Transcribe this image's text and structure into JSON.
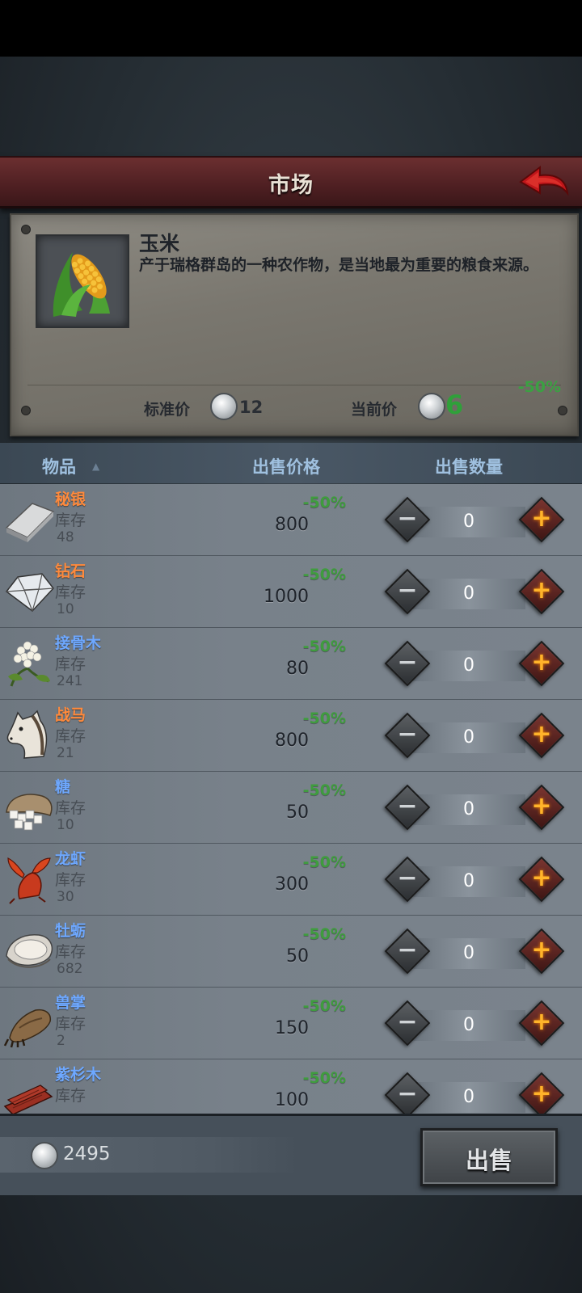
{
  "title": "市场",
  "selected_item": {
    "name": "玉米",
    "description": "产于瑞格群岛的一种农作物，是当地最为重要的粮食来源。",
    "discount": "-50%",
    "standard_price_label": "标准价",
    "standard_price": "12",
    "current_price_label": "当前价",
    "current_price": "6",
    "icon": "corn-icon"
  },
  "table_header": {
    "item": "物品",
    "sell_price": "出售价格",
    "sell_quantity": "出售数量"
  },
  "colors": {
    "blue_name": "#6ea8ff",
    "orange_name": "#ff8a3c",
    "discount_green": "#3f9c3e"
  },
  "items": [
    {
      "name": "秘银",
      "name_color": "#ff8a3c",
      "stock_label": "库存",
      "stock": "48",
      "discount": "-50%",
      "price": "800",
      "qty": "0",
      "icon": "mithril-bar-icon"
    },
    {
      "name": "钻石",
      "name_color": "#ff8a3c",
      "stock_label": "库存",
      "stock": "10",
      "discount": "-50%",
      "price": "1000",
      "qty": "0",
      "icon": "diamond-icon"
    },
    {
      "name": "接骨木",
      "name_color": "#6ea8ff",
      "stock_label": "库存",
      "stock": "241",
      "discount": "-50%",
      "price": "80",
      "qty": "0",
      "icon": "elder-flower-icon"
    },
    {
      "name": "战马",
      "name_color": "#ff8a3c",
      "stock_label": "库存",
      "stock": "21",
      "discount": "-50%",
      "price": "800",
      "qty": "0",
      "icon": "horse-icon"
    },
    {
      "name": "糖",
      "name_color": "#6ea8ff",
      "stock_label": "库存",
      "stock": "10",
      "discount": "-50%",
      "price": "50",
      "qty": "0",
      "icon": "sugar-icon"
    },
    {
      "name": "龙虾",
      "name_color": "#6ea8ff",
      "stock_label": "库存",
      "stock": "30",
      "discount": "-50%",
      "price": "300",
      "qty": "0",
      "icon": "lobster-icon"
    },
    {
      "name": "牡蛎",
      "name_color": "#6ea8ff",
      "stock_label": "库存",
      "stock": "682",
      "discount": "-50%",
      "price": "50",
      "qty": "0",
      "icon": "oyster-icon"
    },
    {
      "name": "兽掌",
      "name_color": "#6ea8ff",
      "stock_label": "库存",
      "stock": "2",
      "discount": "-50%",
      "price": "150",
      "qty": "0",
      "icon": "beast-paw-icon"
    },
    {
      "name": "紫杉木",
      "name_color": "#6ea8ff",
      "stock_label": "库存",
      "stock": "",
      "discount": "-50%",
      "price": "100",
      "qty": "0",
      "icon": "yew-wood-icon"
    }
  ],
  "footer": {
    "money": "2495",
    "sell_button": "出售"
  }
}
